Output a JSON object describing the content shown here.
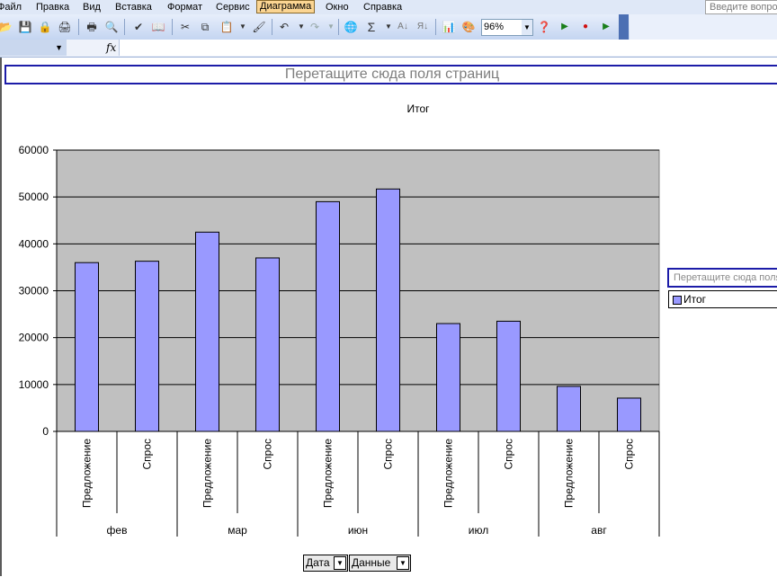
{
  "menu": {
    "items": [
      "Файл",
      "Правка",
      "Вид",
      "Вставка",
      "Формат",
      "Сервис",
      "Диаграмма",
      "Окно",
      "Справка"
    ],
    "active_index": 6,
    "help_placeholder": "Введите вопрос"
  },
  "toolbar": {
    "icons": [
      "open-icon",
      "save-icon",
      "permission-icon",
      "print-icon",
      "print-preview-icon",
      "spelling-icon",
      "research-icon",
      "cut-icon",
      "copy-icon",
      "paste-icon",
      "format-painter-icon",
      "undo-icon",
      "redo-icon",
      "hyperlink-icon",
      "autosum-icon",
      "sort-ascending-icon",
      "sort-descending-icon",
      "chart-wizard-icon",
      "drawing-icon",
      "help-icon",
      "play-icon",
      "record-icon",
      "run-icon"
    ],
    "zoom": "96%"
  },
  "formula_bar": {
    "fx_label": "fx",
    "value": ""
  },
  "pivot": {
    "page_drop_zone": "Перетащите сюда поля страниц",
    "series_drop_zone": "Перетащите сюда поля рядов",
    "field_buttons": [
      "Дата",
      "Данные"
    ]
  },
  "chart_data": {
    "type": "bar",
    "title": "Итог",
    "groups": [
      "фев",
      "мар",
      "июн",
      "июл",
      "авг"
    ],
    "categories": [
      "Предложение",
      "Спрос",
      "Предложение",
      "Спрос",
      "Предложение",
      "Спрос",
      "Предложение",
      "Спрос",
      "Предложение",
      "Спрос"
    ],
    "series": [
      {
        "name": "Итог",
        "values": [
          36000,
          36300,
          42500,
          37000,
          49000,
          51700,
          23000,
          23500,
          9600,
          7100
        ]
      }
    ],
    "ylim": [
      0,
      60000
    ],
    "yticks": [
      0,
      10000,
      20000,
      30000,
      40000,
      50000,
      60000
    ],
    "grid": true,
    "legend_position": "right",
    "colors": {
      "bar": "#9999ff",
      "plot_area": "#c0c0c0"
    }
  }
}
